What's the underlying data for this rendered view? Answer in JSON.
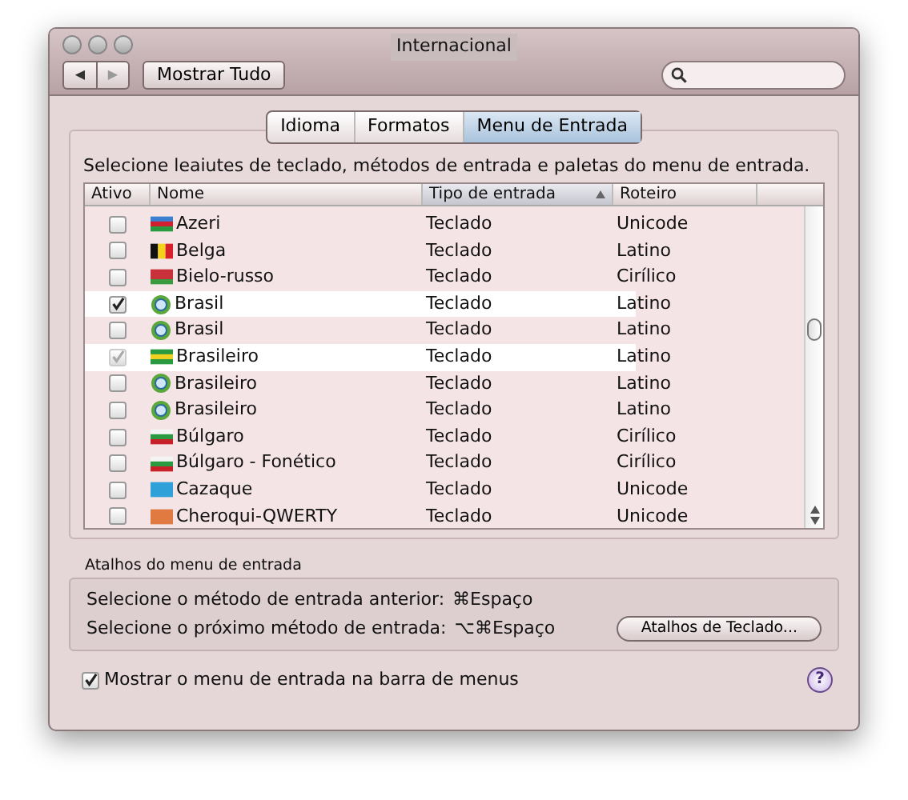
{
  "window": {
    "title": "Internacional"
  },
  "toolbar": {
    "back": "◀",
    "forward": "▶",
    "show_all": "Mostrar Tudo",
    "search": {
      "kind": "field"
    }
  },
  "tabs": [
    {
      "label": "Idioma",
      "selected": false
    },
    {
      "label": "Formatos",
      "selected": false
    },
    {
      "label": "Menu de Entrada",
      "selected": true
    }
  ],
  "instructions": "Selecione leaiutes de teclado, métodos de entrada e paletas do menu de entrada.",
  "table": {
    "columns": [
      {
        "label": "Ativo",
        "sorted": false
      },
      {
        "label": "Nome",
        "sorted": false
      },
      {
        "label": "Tipo de entrada",
        "sorted": true
      },
      {
        "label": "Roteiro",
        "sorted": false
      }
    ],
    "rows": [
      {
        "name": "Azeri",
        "type": "Teclado",
        "script": "Unicode",
        "checked": false,
        "disabled": false,
        "highlighted": false,
        "kind": "azeri"
      },
      {
        "name": "Belga",
        "type": "Teclado",
        "script": "Latino",
        "checked": false,
        "disabled": false,
        "highlighted": false,
        "kind": "belgian"
      },
      {
        "name": "Bielo-russo",
        "type": "Teclado",
        "script": "Cirílico",
        "checked": false,
        "disabled": false,
        "highlighted": false,
        "kind": "belarusian"
      },
      {
        "name": "Brasil",
        "type": "Teclado",
        "script": "Latino",
        "checked": true,
        "disabled": false,
        "highlighted": true,
        "kind": "globe"
      },
      {
        "name": "Brasil",
        "type": "Teclado",
        "script": "Latino",
        "checked": false,
        "disabled": false,
        "highlighted": false,
        "kind": "globe"
      },
      {
        "name": "Brasileiro",
        "type": "Teclado",
        "script": "Latino",
        "checked": true,
        "disabled": true,
        "highlighted": true,
        "kind": "brazilian"
      },
      {
        "name": "Brasileiro",
        "type": "Teclado",
        "script": "Latino",
        "checked": false,
        "disabled": false,
        "highlighted": false,
        "kind": "globe"
      },
      {
        "name": "Brasileiro",
        "type": "Teclado",
        "script": "Latino",
        "checked": false,
        "disabled": false,
        "highlighted": false,
        "kind": "globe"
      },
      {
        "name": "Búlgaro",
        "type": "Teclado",
        "script": "Cirílico",
        "checked": false,
        "disabled": false,
        "highlighted": false,
        "kind": "bulgarian"
      },
      {
        "name": "Búlgaro - Fonético",
        "type": "Teclado",
        "script": "Cirílico",
        "checked": false,
        "disabled": false,
        "highlighted": false,
        "kind": "bulgarian"
      },
      {
        "name": "Cazaque",
        "type": "Teclado",
        "script": "Unicode",
        "checked": false,
        "disabled": false,
        "highlighted": false,
        "kind": "kazakh"
      },
      {
        "name": "Cheroqui-QWERTY",
        "type": "Teclado",
        "script": "Unicode",
        "checked": false,
        "disabled": false,
        "highlighted": false,
        "kind": "cherokee"
      }
    ]
  },
  "shortcuts": {
    "title": "Atalhos do menu de entrada",
    "lines": [
      {
        "label": "Selecione o método de entrada anterior:",
        "keys": "⌘Espaço"
      },
      {
        "label": "Selecione o próximo método de entrada:",
        "keys": "⌥⌘Espaço"
      }
    ],
    "button": "Atalhos de Teclado..."
  },
  "show_in_menu_bar": {
    "label": "Mostrar o menu de entrada na barra de menus",
    "checked": true
  },
  "help": "?"
}
